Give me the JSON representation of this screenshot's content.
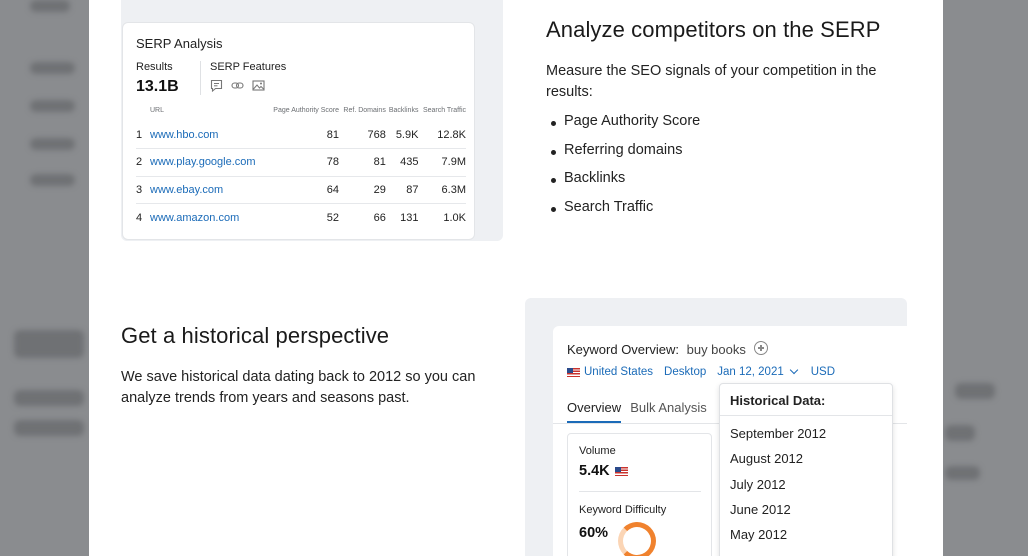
{
  "serp_section": {
    "heading": "Analyze competitors on the SERP",
    "description": "Measure the SEO signals of your competition in the results:",
    "bullets": [
      "Page Authority Score",
      "Referring domains",
      "Backlinks",
      "Search Traffic"
    ],
    "card": {
      "title": "SERP Analysis",
      "results_label": "Results",
      "results_value": "13.1B",
      "features_label": "SERP Features",
      "feature_icons": [
        "answer-box-icon",
        "link-icon",
        "image-icon"
      ],
      "columns": [
        "URL",
        "Page Authority Score",
        "Ref. Domains",
        "Backlinks",
        "Search Traffic"
      ],
      "rows": [
        {
          "n": "1",
          "url": "www.hbo.com",
          "pa": "81",
          "ref": "768",
          "bl": "5.9K",
          "traffic": "12.8K"
        },
        {
          "n": "2",
          "url": "www.play.google.com",
          "pa": "78",
          "ref": "81",
          "bl": "435",
          "traffic": "7.9M"
        },
        {
          "n": "3",
          "url": "www.ebay.com",
          "pa": "64",
          "ref": "29",
          "bl": "87",
          "traffic": "6.3M"
        },
        {
          "n": "4",
          "url": "www.amazon.com",
          "pa": "52",
          "ref": "66",
          "bl": "131",
          "traffic": "1.0K"
        }
      ]
    }
  },
  "history_section": {
    "heading": "Get a historical perspective",
    "description": "We save historical data dating back to 2012 so you can analyze trends from years and seasons past.",
    "card": {
      "title": "Keyword Overview:",
      "keyword": "buy books",
      "country": "United States",
      "device": "Desktop",
      "date": "Jan 12, 2021",
      "currency": "USD",
      "tabs": [
        "Overview",
        "Bulk Analysis"
      ],
      "volume_label": "Volume",
      "volume_value": "5.4K",
      "kd_label": "Keyword Difficulty",
      "kd_value": "60%",
      "dropdown": {
        "header": "Historical Data:",
        "items": [
          "September 2012",
          "August 2012",
          "July 2012",
          "June 2012",
          "May 2012"
        ]
      }
    }
  },
  "colors": {
    "link": "#1b6bb8",
    "accent": "#f0822e",
    "panel": "#eef0f3"
  }
}
